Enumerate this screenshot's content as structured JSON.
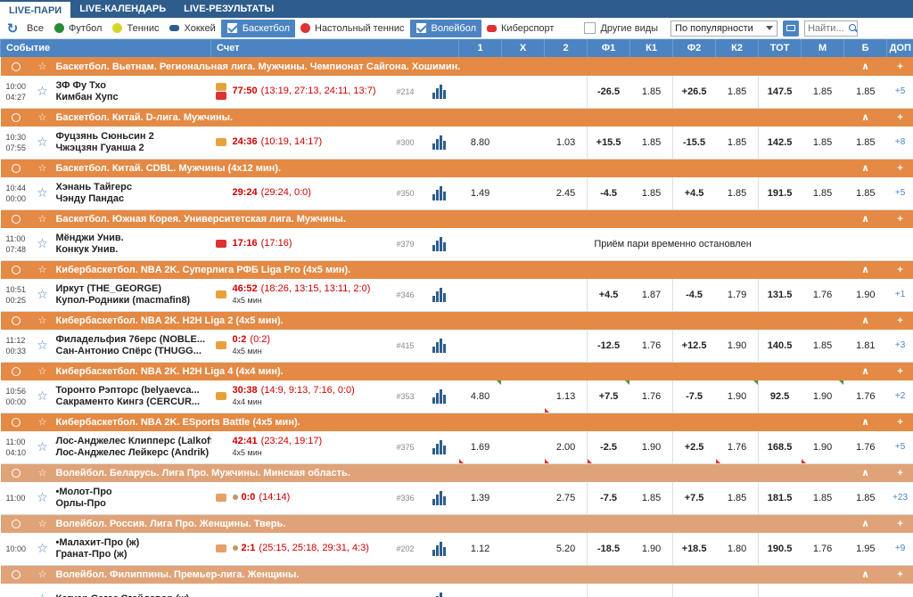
{
  "nav": {
    "tabs": [
      "LIVE-ПАРИ",
      "LIVE-КАЛЕНДАРЬ",
      "LIVE-РЕЗУЛЬТАТЫ"
    ]
  },
  "filters": {
    "all": "Все",
    "football": "Футбол",
    "tennis": "Теннис",
    "hockey": "Хоккей",
    "basketball": "Баскетбол",
    "table_tennis": "Настольный теннис",
    "volleyball": "Волейбол",
    "esports": "Киберспорт",
    "other": "Другие виды",
    "sort_value": "По популярности",
    "search_placeholder": "Найти..."
  },
  "colors": {
    "nav": "#2e5d8c",
    "header": "#4c84c2",
    "league_basket": "#e48a45",
    "league_volley": "#e0a378",
    "odds_bg": "#cfe3ef",
    "score": "#cc0000"
  },
  "header": {
    "event": "Событие",
    "score": "Счет",
    "cols": [
      "1",
      "X",
      "2",
      "Ф1",
      "К1",
      "Ф2",
      "К2",
      "ТОТ",
      "М",
      "Б",
      "ДОП"
    ]
  },
  "suspended_text": "Приём пари временно остановлен",
  "rows": [
    {
      "kind": "league",
      "sport": "basket",
      "name": "Баскетбол. Вьетнам. Региональная лига. Мужчины. Чемпионат Сайгона. Хошимин."
    },
    {
      "kind": "event",
      "t1": "10:00",
      "t2": "04:27",
      "team1": "ЗФ Фу Тхо",
      "team2": "Кимбан Хупс",
      "icons": [
        "stat",
        "video"
      ],
      "score": "77:50",
      "detail": "(13:19, 27:13, 24:11, 13:7)",
      "sub": "",
      "num": "#214",
      "odds": [
        "",
        "",
        "",
        "-26.5",
        "1.85",
        "+26.5",
        "1.85",
        "147.5",
        "1.85",
        "1.85",
        "+5"
      ],
      "tri": []
    },
    {
      "kind": "league",
      "sport": "basket",
      "name": "Баскетбол. Китай. D-лига. Мужчины."
    },
    {
      "kind": "event",
      "t1": "10:30",
      "t2": "07:55",
      "team1": "Фуцзянь Сюньсин 2",
      "team2": "Чжэцзян Гуанша 2",
      "icons": [
        "stat"
      ],
      "score": "24:36",
      "detail": "(10:19, 14:17)",
      "sub": "",
      "num": "#300",
      "odds": [
        "8.80",
        "",
        "1.03",
        "+15.5",
        "1.85",
        "-15.5",
        "1.85",
        "142.5",
        "1.85",
        "1.85",
        "+8"
      ],
      "tri": []
    },
    {
      "kind": "league",
      "sport": "basket",
      "name": "Баскетбол. Китай. CDBL. Мужчины (4x12 мин)."
    },
    {
      "kind": "event",
      "t1": "10:44",
      "t2": "00:00",
      "team1": "Хэнань Тайгерс",
      "team2": "Чэнду Пандас",
      "icons": [],
      "score": "29:24",
      "detail": "(29:24, 0:0)",
      "sub": "",
      "num": "#350",
      "odds": [
        "1.49",
        "",
        "2.45",
        "-4.5",
        "1.85",
        "+4.5",
        "1.85",
        "191.5",
        "1.85",
        "1.85",
        "+5"
      ],
      "tri": []
    },
    {
      "kind": "league",
      "sport": "basket",
      "name": "Баскетбол. Южная Корея. Университетская лига. Мужчины."
    },
    {
      "kind": "event",
      "t1": "11:00",
      "t2": "07:48",
      "team1": "Мёнджи Унив.",
      "team2": "Конкук Унив.",
      "icons": [
        "video"
      ],
      "score": "17:16",
      "detail": "(17:16)",
      "sub": "",
      "num": "#379",
      "suspended": true,
      "tri": []
    },
    {
      "kind": "league",
      "sport": "basket",
      "name": "Кибербаскетбол. NBA 2K. Суперлига РФБ Liga Pro (4x5 мин)."
    },
    {
      "kind": "event",
      "t1": "10:51",
      "t2": "00:25",
      "team1": "Иркут (THE_GEORGE)",
      "team2": "Купол-Родники (macmafin8)",
      "icons": [
        "stat"
      ],
      "score": "46:52",
      "detail": "(18:26, 13:15, 13:11, 2:0)",
      "sub": "4x5 мин",
      "num": "#346",
      "odds": [
        "",
        "",
        "",
        "+4.5",
        "1.87",
        "-4.5",
        "1.79",
        "131.5",
        "1.76",
        "1.90",
        "+1"
      ],
      "tri": []
    },
    {
      "kind": "league",
      "sport": "basket",
      "name": "Кибербаскетбол. NBA 2K. H2H Liga 2 (4x5 мин)."
    },
    {
      "kind": "event",
      "t1": "11:12",
      "t2": "00:33",
      "team1": "Филадельфия 76ерс (NOBLE...",
      "team2": "Сан-Антонио Спёрс (THUGG...",
      "icons": [
        "stat"
      ],
      "score": "0:2",
      "detail": "(0:2)",
      "sub": "4x5 мин",
      "num": "#415",
      "odds": [
        "",
        "",
        "",
        "-12.5",
        "1.76",
        "+12.5",
        "1.90",
        "140.5",
        "1.85",
        "1.81",
        "+3"
      ],
      "tri": []
    },
    {
      "kind": "league",
      "sport": "basket",
      "name": "Кибербаскетбол. NBA 2K. H2H Liga 4 (4x4 мин)."
    },
    {
      "kind": "event",
      "t1": "10:56",
      "t2": "00:00",
      "team1": "Торонто Рэпторс (belyaevca...",
      "team2": "Сакраменто Кингз (CERCUR...",
      "icons": [
        "stat"
      ],
      "score": "30:38",
      "detail": "(14:9, 9:13, 7:16, 0:0)",
      "sub": "4x4 мин",
      "num": "#353",
      "odds": [
        "4.80",
        "",
        "1.13",
        "+7.5",
        "1.76",
        "-7.5",
        "1.90",
        "92.5",
        "1.90",
        "1.76",
        "+2"
      ],
      "tri": [
        "g0",
        "r2",
        "g3",
        "g6",
        "g8"
      ]
    },
    {
      "kind": "league",
      "sport": "basket",
      "name": "Кибербаскетбол. NBA 2K. ESports Battle (4x5 мин)."
    },
    {
      "kind": "event",
      "t1": "11:00",
      "t2": "04:10",
      "team1": "Лос-Анджелес Клипперс (Lalkoff)",
      "team2": "Лос-Анджелес Лейкерс (Andrik)",
      "icons": [],
      "score": "42:41",
      "detail": "(23:24, 19:17)",
      "sub": "4x5 мин",
      "num": "#375",
      "odds": [
        "1.69",
        "",
        "2.00",
        "-2.5",
        "1.90",
        "+2.5",
        "1.76",
        "168.5",
        "1.90",
        "1.76",
        "+5"
      ],
      "tri": [
        "r0",
        "r2",
        "r3",
        "r6",
        "r8"
      ]
    },
    {
      "kind": "league",
      "sport": "volley",
      "name": "Волейбол. Беларусь. Лига Про. Мужчины. Минская область."
    },
    {
      "kind": "event",
      "t1": "11:00",
      "t2": "",
      "team1": "•Молот-Про",
      "team2": "Орлы-Про",
      "icons": [
        "grid"
      ],
      "score": "0:0",
      "detail": "(14:14)",
      "sub": "",
      "num": "#336",
      "dot": true,
      "odds": [
        "1.39",
        "",
        "2.75",
        "-7.5",
        "1.85",
        "+7.5",
        "1.85",
        "181.5",
        "1.85",
        "1.85",
        "+23"
      ],
      "tri": []
    },
    {
      "kind": "league",
      "sport": "volley",
      "name": "Волейбол. Россия. Лига Про. Женщины. Тверь."
    },
    {
      "kind": "event",
      "t1": "10:00",
      "t2": "",
      "team1": "•Малахит-Про (ж)",
      "team2": "Гранат-Про (ж)",
      "icons": [
        "grid"
      ],
      "score": "2:1",
      "detail": "(25:15, 25:18, 29:31, 4:3)",
      "sub": "",
      "num": "#202",
      "dot": true,
      "odds": [
        "1.12",
        "",
        "5.20",
        "-18.5",
        "1.90",
        "+18.5",
        "1.80",
        "190.5",
        "1.76",
        "1.95",
        "+9"
      ],
      "tri": []
    },
    {
      "kind": "league",
      "sport": "volley",
      "name": "Волейбол. Филиппины. Премьер-лига. Женщины."
    },
    {
      "kind": "event",
      "t1": "",
      "t2": "",
      "team1": "Кагуар Сагаз Сгайдавор (ж)",
      "team2": "",
      "icons": [],
      "score": "",
      "detail": "",
      "sub": "",
      "num": "",
      "odds": [
        "",
        "",
        "",
        "",
        "",
        "",
        "",
        "",
        "",
        "",
        ""
      ],
      "tri": []
    }
  ]
}
